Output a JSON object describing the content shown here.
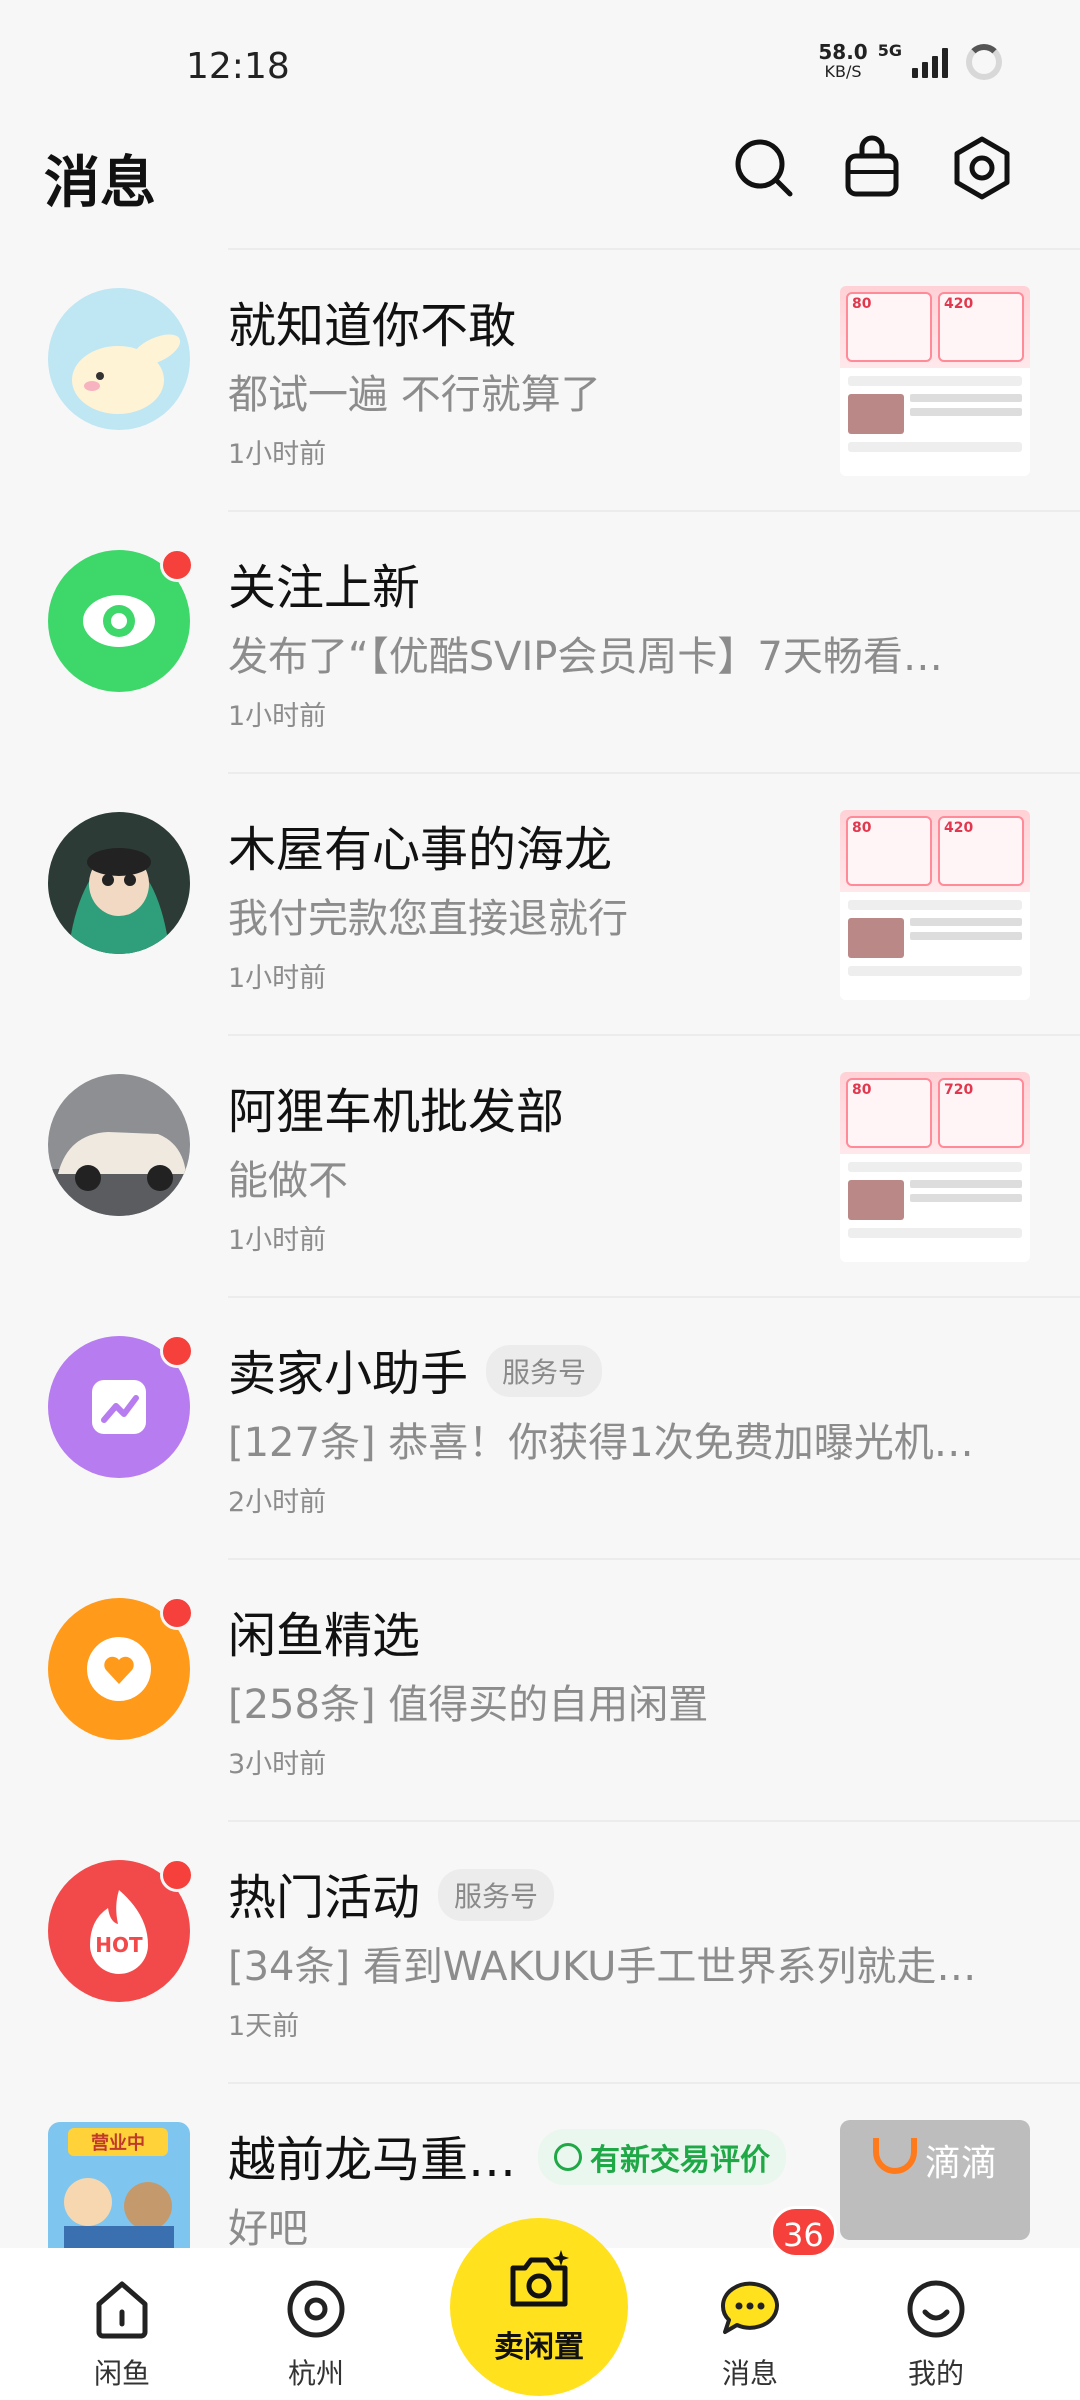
{
  "status_bar": {
    "time": "12:18",
    "net_speed": "58.0",
    "net_unit": "KB/S",
    "network": "5G"
  },
  "header": {
    "title": "消息",
    "icons": [
      "search-icon",
      "bag-icon",
      "settings-icon"
    ]
  },
  "conversations": [
    {
      "name": "就知道你不敢",
      "message": "都试一遍  不行就算了",
      "time": "1小时前",
      "unread_dot": false,
      "has_thumbnail": true
    },
    {
      "name": "关注上新",
      "message": "发布了“【优酷SVIP会员周卡】7天畅看…",
      "time": "1小时前",
      "unread_dot": true,
      "has_thumbnail": false
    },
    {
      "name": "木屋有心事的海龙",
      "message": "我付完款您直接退就行",
      "time": "1小时前",
      "unread_dot": false,
      "has_thumbnail": true
    },
    {
      "name": "阿狸车机批发部",
      "message": "能做不",
      "time": "1小时前",
      "unread_dot": false,
      "has_thumbnail": true
    },
    {
      "name": "卖家小助手",
      "tag": "服务号",
      "message": "[127条] 恭喜！你获得1次免费加曝光机…",
      "time": "2小时前",
      "unread_dot": true,
      "has_thumbnail": false
    },
    {
      "name": "闲鱼精选",
      "message": "[258条] 值得买的自用闲置",
      "time": "3小时前",
      "unread_dot": true,
      "has_thumbnail": false
    },
    {
      "name": "热门活动",
      "tag": "服务号",
      "message": "[34条] 看到WAKUKU手工世界系列就走…",
      "time": "1天前",
      "unread_dot": true,
      "has_thumbnail": false
    },
    {
      "name": "越前龙马重…",
      "praise_tag": "有新交易评价",
      "message": "好吧",
      "avatar_badge": "营业中",
      "overlay_text": "滴滴"
    }
  ],
  "thumbnail": {
    "price_a": "80",
    "price_b": "420",
    "price_c": "720"
  },
  "hot_logo": "HOT",
  "bottom_nav": {
    "home": "闲鱼",
    "city": "杭州",
    "sell": "卖闲置",
    "messages": "消息",
    "messages_badge": "36",
    "me": "我的"
  },
  "colors": {
    "accent_yellow": "#ffe11e",
    "unread_red": "#f5403b",
    "praise_green": "#1fa846"
  }
}
